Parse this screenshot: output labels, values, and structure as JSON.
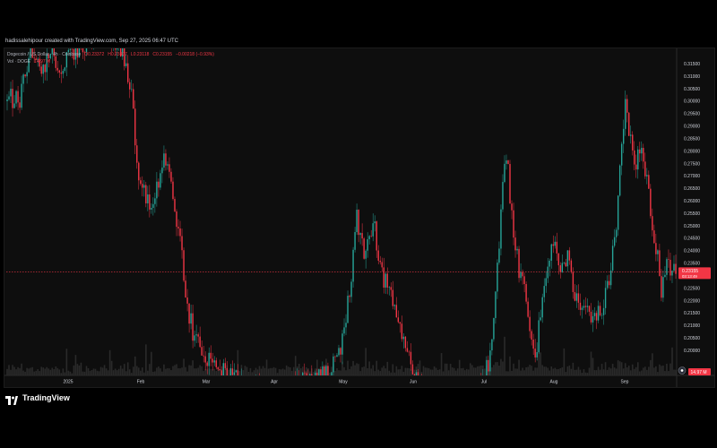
{
  "caption": "hadissalehipour created with TradingView.com, Sep 27, 2025 06:47 UTC",
  "legend": {
    "symbol": "Dogecoin / US Dollar · 4h · Coinbase",
    "o": "O0.23372",
    "h": "H0.23407",
    "l": "L0.23118",
    "c": "C0.23155",
    "change": "−0.00218 (−0.93%)",
    "vol_label": "Vol · DOGE",
    "vol_value": "14.97 M"
  },
  "brand": {
    "name": "TradingView"
  },
  "colors": {
    "up": "#26a69a",
    "down": "#f23645",
    "volume": "#2a2a2a",
    "text": "#b2b5be"
  },
  "icons": [
    "tradingview-logo-icon",
    "gear-icon"
  ],
  "chart_data": {
    "type": "candlestick",
    "x_axis_labels": [
      "2025",
      "Feb",
      "Mar",
      "Apr",
      "May",
      "Jun",
      "Jul",
      "Aug",
      "Sep"
    ],
    "y_axis_labels": [
      "0.31500",
      "0.31000",
      "0.30500",
      "0.30000",
      "0.29500",
      "0.29000",
      "0.28500",
      "0.28000",
      "0.27500",
      "0.27000",
      "0.26500",
      "0.26000",
      "0.25500",
      "0.25000",
      "0.24500",
      "0.24000",
      "0.23500",
      "0.23000",
      "0.22500",
      "0.22000",
      "0.21500",
      "0.21000",
      "0.20500",
      "0.20000"
    ],
    "ylim": [
      0.1945,
      0.3187
    ],
    "last_price": "0.23155",
    "last_price_countdown": "03:13:49",
    "volume_badge": "14.97 M",
    "price_path": [
      [
        0.0,
        0.3
      ],
      [
        0.02,
        0.302
      ],
      [
        0.035,
        0.3195
      ],
      [
        0.05,
        0.312
      ],
      [
        0.065,
        0.319
      ],
      [
        0.08,
        0.313
      ],
      [
        0.095,
        0.3195
      ],
      [
        0.12,
        0.325
      ],
      [
        0.15,
        0.33
      ],
      [
        0.175,
        0.316
      ],
      [
        0.186,
        0.304
      ],
      [
        0.192,
        0.283
      ],
      [
        0.197,
        0.268
      ],
      [
        0.205,
        0.262
      ],
      [
        0.215,
        0.257
      ],
      [
        0.225,
        0.265
      ],
      [
        0.235,
        0.276
      ],
      [
        0.245,
        0.265
      ],
      [
        0.255,
        0.252
      ],
      [
        0.26,
        0.24
      ],
      [
        0.265,
        0.229
      ],
      [
        0.27,
        0.216
      ],
      [
        0.28,
        0.206
      ],
      [
        0.29,
        0.2
      ],
      [
        0.3,
        0.196
      ],
      [
        0.33,
        0.19
      ],
      [
        0.36,
        0.185
      ],
      [
        0.4,
        0.183
      ],
      [
        0.45,
        0.188
      ],
      [
        0.48,
        0.19
      ],
      [
        0.495,
        0.196
      ],
      [
        0.505,
        0.21
      ],
      [
        0.515,
        0.232
      ],
      [
        0.522,
        0.253
      ],
      [
        0.535,
        0.24
      ],
      [
        0.548,
        0.252
      ],
      [
        0.555,
        0.235
      ],
      [
        0.565,
        0.228
      ],
      [
        0.575,
        0.221
      ],
      [
        0.585,
        0.214
      ],
      [
        0.595,
        0.2
      ],
      [
        0.61,
        0.188
      ],
      [
        0.65,
        0.17
      ],
      [
        0.69,
        0.175
      ],
      [
        0.715,
        0.19
      ],
      [
        0.725,
        0.203
      ],
      [
        0.732,
        0.228
      ],
      [
        0.738,
        0.25
      ],
      [
        0.745,
        0.284
      ],
      [
        0.752,
        0.262
      ],
      [
        0.76,
        0.24
      ],
      [
        0.77,
        0.228
      ],
      [
        0.778,
        0.215
      ],
      [
        0.785,
        0.205
      ],
      [
        0.79,
        0.198
      ],
      [
        0.8,
        0.22
      ],
      [
        0.81,
        0.238
      ],
      [
        0.82,
        0.245
      ],
      [
        0.828,
        0.23
      ],
      [
        0.838,
        0.24
      ],
      [
        0.848,
        0.222
      ],
      [
        0.858,
        0.217
      ],
      [
        0.868,
        0.22
      ],
      [
        0.878,
        0.212
      ],
      [
        0.888,
        0.215
      ],
      [
        0.898,
        0.225
      ],
      [
        0.91,
        0.248
      ],
      [
        0.92,
        0.282
      ],
      [
        0.925,
        0.305
      ],
      [
        0.93,
        0.29
      ],
      [
        0.94,
        0.276
      ],
      [
        0.948,
        0.283
      ],
      [
        0.955,
        0.272
      ],
      [
        0.962,
        0.258
      ],
      [
        0.97,
        0.243
      ],
      [
        0.978,
        0.225
      ],
      [
        0.985,
        0.234
      ],
      [
        1.0,
        0.2316
      ]
    ]
  }
}
